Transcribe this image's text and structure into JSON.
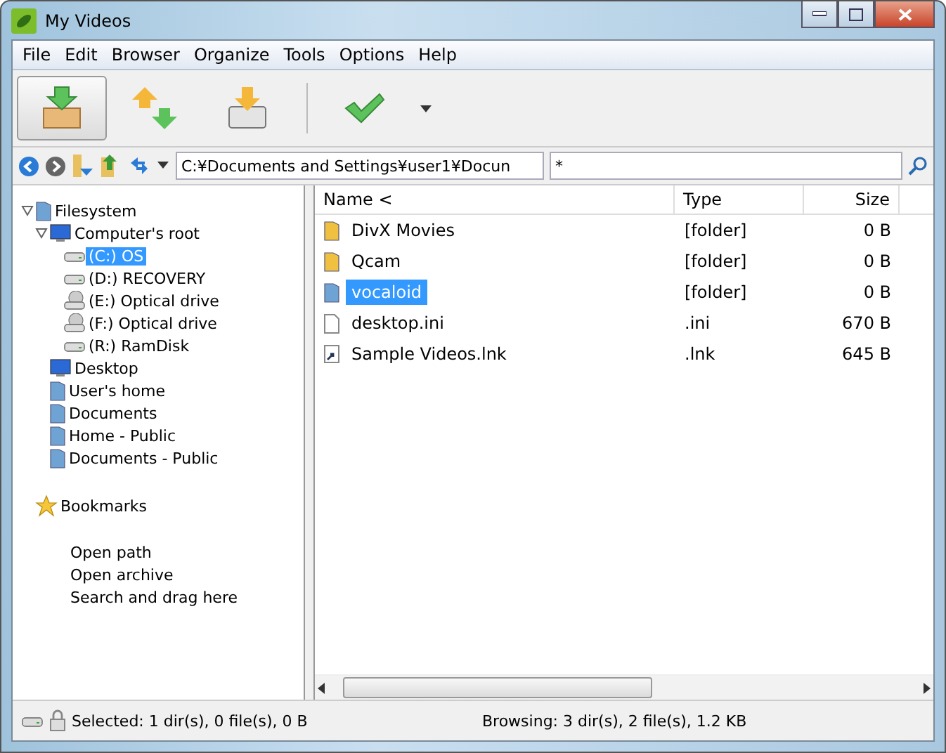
{
  "window": {
    "title": "My Videos"
  },
  "menu": [
    "File",
    "Edit",
    "Browser",
    "Organize",
    "Tools",
    "Options",
    "Help"
  ],
  "toolbar": [
    {
      "kind": "box",
      "pressed": true
    },
    {
      "kind": "swap",
      "pressed": false
    },
    {
      "kind": "drive",
      "pressed": false
    },
    {
      "kind": "separator"
    },
    {
      "kind": "check",
      "pressed": false
    },
    {
      "kind": "dropdown"
    }
  ],
  "address": {
    "path": "C:¥Documents and Settings¥user1¥Docun",
    "filter": "*"
  },
  "tree": [
    {
      "label": "Filesystem",
      "kind": "folder",
      "expanded": true,
      "selected": false,
      "children": [
        {
          "label": "Computer's root",
          "kind": "computer",
          "expanded": true,
          "selected": false,
          "children": [
            {
              "label": "(C:) OS",
              "kind": "drive",
              "selected": true
            },
            {
              "label": "(D:) RECOVERY",
              "kind": "drive",
              "selected": false
            },
            {
              "label": "(E:) Optical drive",
              "kind": "optical",
              "selected": false
            },
            {
              "label": "(F:) Optical drive",
              "kind": "optical",
              "selected": false
            },
            {
              "label": "(R:) RamDisk",
              "kind": "drive",
              "selected": false
            }
          ]
        },
        {
          "label": "Desktop",
          "kind": "computer",
          "selected": false
        },
        {
          "label": "User's home",
          "kind": "folder",
          "selected": false
        },
        {
          "label": "Documents",
          "kind": "folder",
          "selected": false
        },
        {
          "label": "Home - Public",
          "kind": "folder",
          "selected": false
        },
        {
          "label": "Documents - Public",
          "kind": "folder",
          "selected": false
        }
      ]
    }
  ],
  "bookmarks": {
    "label": "Bookmarks",
    "links": [
      "Open path",
      "Open archive",
      "Search and drag here"
    ]
  },
  "table": {
    "columns": [
      "Name <",
      "Type",
      "Size"
    ],
    "rows": [
      {
        "name": "DivX Movies",
        "type": "[folder]",
        "size": "0 B",
        "kind": "folder",
        "selected": false
      },
      {
        "name": "Qcam",
        "type": "[folder]",
        "size": "0 B",
        "kind": "folder",
        "selected": false
      },
      {
        "name": "vocaloid",
        "type": "[folder]",
        "size": "0 B",
        "kind": "folder",
        "selected": true
      },
      {
        "name": "desktop.ini",
        "type": ".ini",
        "size": "670 B",
        "kind": "file",
        "selected": false
      },
      {
        "name": "Sample Videos.lnk",
        "type": ".lnk",
        "size": "645 B",
        "kind": "link",
        "selected": false
      }
    ]
  },
  "status_bar": {
    "selected": "Selected: 1 dir(s), 0 file(s), 0 B",
    "browsing": "Browsing: 3 dir(s), 2 file(s), 1.2 KB"
  }
}
